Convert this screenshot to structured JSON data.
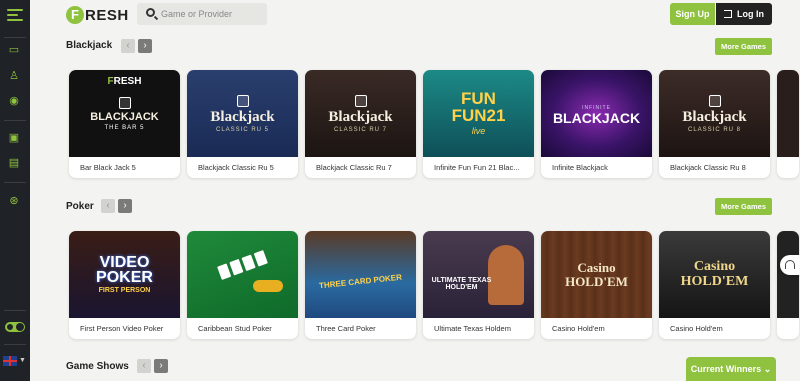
{
  "brand": {
    "logo_letter": "F",
    "logo_word": "RESH"
  },
  "search": {
    "placeholder": "Game or Provider"
  },
  "auth": {
    "signup": "Sign Up",
    "login": "Log In"
  },
  "sections": [
    {
      "title": "Blackjack",
      "more_label": "More Games",
      "games": [
        {
          "name": "Bar Black Jack 5",
          "art_title": "BLACKJACK",
          "art_sub": "THE BAR 5"
        },
        {
          "name": "Blackjack Classic Ru 5",
          "art_title": "Blackjack",
          "art_sub": "CLASSIC RU 5"
        },
        {
          "name": "Blackjack Classic Ru 7",
          "art_title": "Blackjack",
          "art_sub": "CLASSIC RU 7"
        },
        {
          "name": "Infinite Fun Fun 21 Blac...",
          "art_title": "FUN FUN21",
          "art_sub": "live"
        },
        {
          "name": "Infinite Blackjack",
          "art_title": "BLACKJACK",
          "art_sub": "INFINITE"
        },
        {
          "name": "Blackjack Classic Ru 8",
          "art_title": "Blackjack",
          "art_sub": "CLASSIC RU 8"
        }
      ]
    },
    {
      "title": "Poker",
      "more_label": "More Games",
      "games": [
        {
          "name": "First Person Video Poker",
          "art_title": "VIDEO POKER",
          "art_sub": "FIRST PERSON"
        },
        {
          "name": "Caribbean Stud Poker",
          "art_title": "",
          "art_sub": ""
        },
        {
          "name": "Three Card Poker",
          "art_title": "THREE CARD POKER",
          "art_sub": ""
        },
        {
          "name": "Ultimate Texas Holdem",
          "art_title": "ULTIMATE TEXAS HOLD'EM",
          "art_sub": ""
        },
        {
          "name": "Casino Hold'em",
          "art_title": "Casino HOLD'EM",
          "art_sub": ""
        },
        {
          "name": "Casino Hold'em",
          "art_title": "Casino HOLD'EM",
          "art_sub": ""
        }
      ]
    },
    {
      "title": "Game Shows",
      "more_label": "Current Winners"
    }
  ],
  "theme": {
    "accent": "#8fc23f",
    "sidebar": "#1f2226",
    "background": "#f3f3f1"
  }
}
